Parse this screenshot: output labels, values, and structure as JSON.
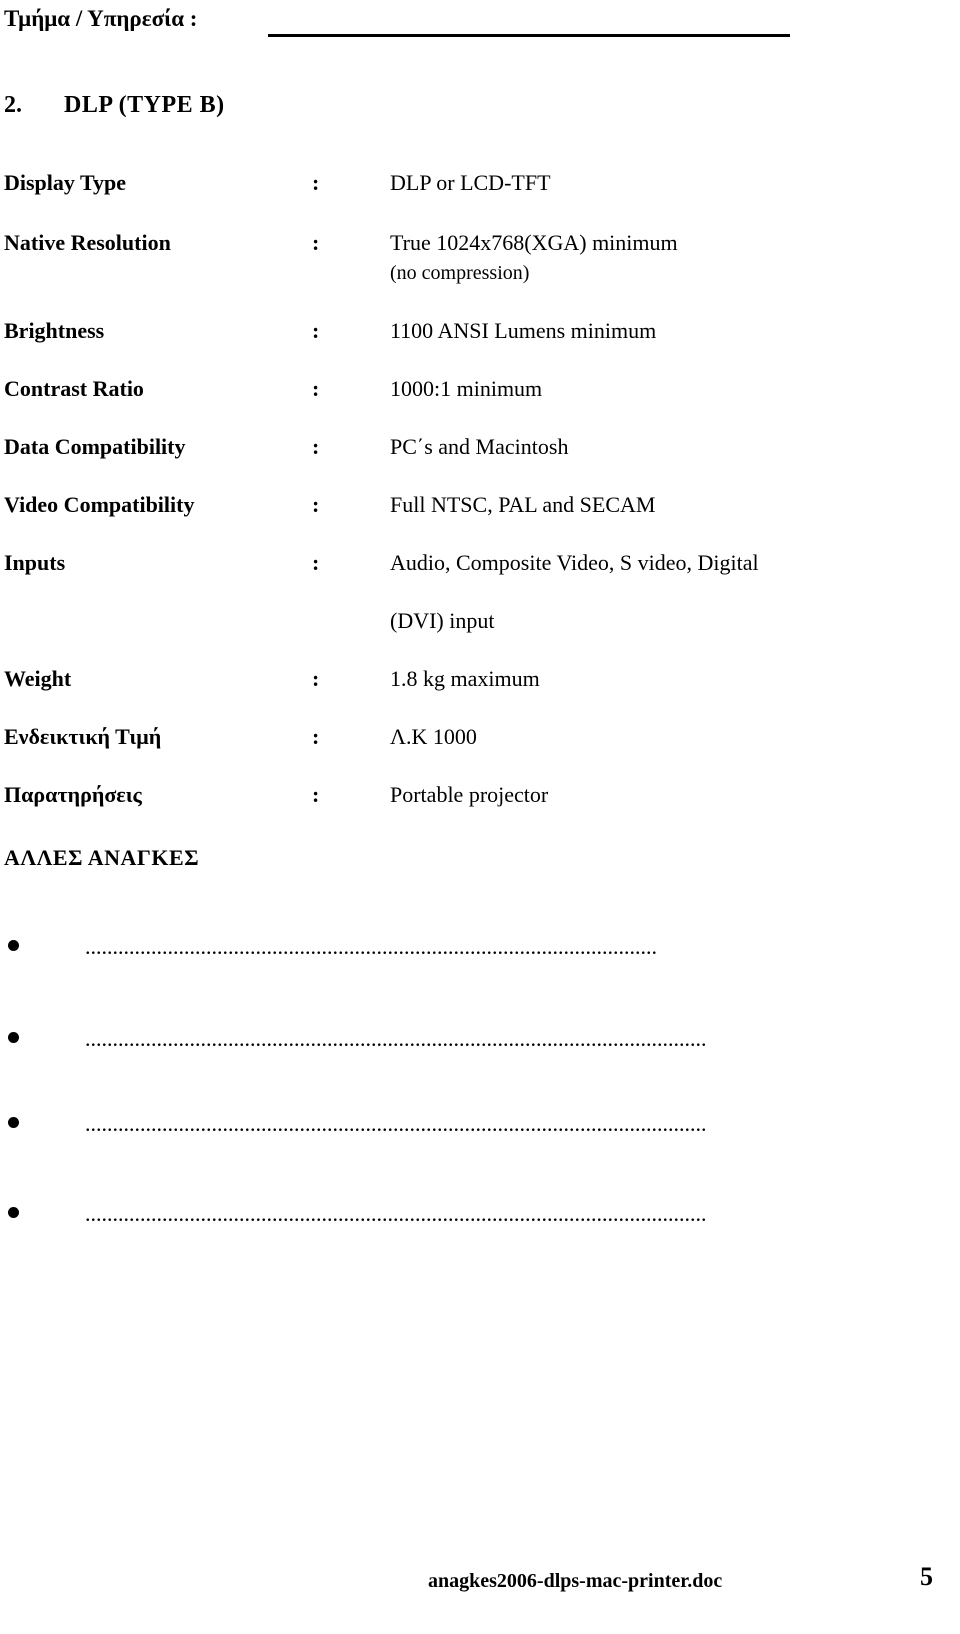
{
  "header": {
    "label": "Τμήμα / Υπηρεσία :",
    "rule": true
  },
  "section": {
    "number": "2.",
    "title": "DLP  (TYPE B)"
  },
  "specs": [
    {
      "label": "Display Type",
      "colon": ":",
      "value": "DLP or LCD-TFT",
      "value_cont": ""
    },
    {
      "label": "Native Resolution",
      "colon": ":",
      "value": "True 1024x768(XGA) minimum",
      "value_cont": "(no compression)"
    },
    {
      "label": "Brightness",
      "colon": ":",
      "value": "1100 ANSI Lumens minimum",
      "value_cont": ""
    },
    {
      "label": "Contrast Ratio",
      "colon": ":",
      "value": "1000:1 minimum",
      "value_cont": ""
    },
    {
      "label": "Data Compatibility",
      "colon": ":",
      "value": "PC΄s and Macintosh",
      "value_cont": ""
    },
    {
      "label": "Video Compatibility",
      "colon": ":",
      "value": "Full NTSC, PAL and SECAM",
      "value_cont": ""
    },
    {
      "label": "Inputs",
      "colon": ":",
      "value": "Audio, Composite Video, S video, Digital",
      "value_cont": "(DVI) input"
    },
    {
      "label": "Weight",
      "colon": ":",
      "value": "1.8 kg maximum",
      "value_cont": ""
    },
    {
      "label": "Ενδεικτική Τιμή",
      "colon": ":",
      "value": "Λ.Κ 1000",
      "value_cont": ""
    },
    {
      "label": "Παρατηρήσεις",
      "colon": ":",
      "value": "Portable projector",
      "value_cont": ""
    }
  ],
  "other_needs": {
    "title": "ΑΛΛΕΣ  ΑΝΑΓΚΕΣ",
    "bullets": [
      {
        "dots": "........................................................................................................"
      },
      {
        "dots": "................................................................................................................."
      },
      {
        "dots": "................................................................................................................."
      },
      {
        "dots": "................................................................................................................."
      }
    ]
  },
  "footer": {
    "filename": "anagkes2006-dlps-mac-printer.doc",
    "page_number": "5"
  }
}
